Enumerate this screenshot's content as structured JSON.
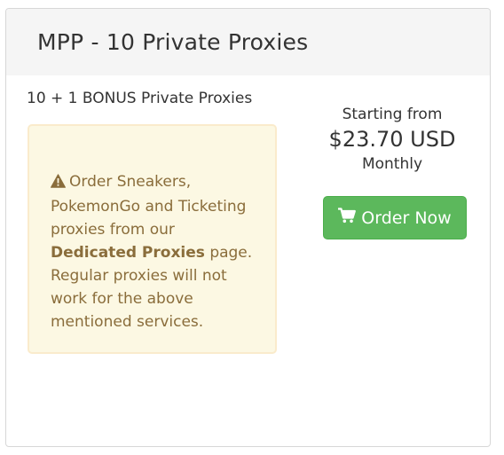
{
  "header": {
    "title": "MPP - 10 Private Proxies"
  },
  "product": {
    "subtitle": "10 + 1 BONUS Private Proxies"
  },
  "notice": {
    "icon": "warning-icon",
    "line1": "Order Sneakers, PokemonGo and Ticketing proxies from our",
    "link_text": "Dedicated Proxies",
    "line2": "page. Regular proxies will not work for the above mentioned services."
  },
  "pricing": {
    "starting_label": "Starting from",
    "price": "$23.70 USD",
    "period": "Monthly"
  },
  "order_button": {
    "icon": "cart-icon",
    "label": "Order Now"
  },
  "colors": {
    "button_bg": "#5cb85c",
    "notice_bg": "#fcf8e3",
    "notice_text": "#8a6d3b",
    "header_bg": "#f5f5f5"
  }
}
